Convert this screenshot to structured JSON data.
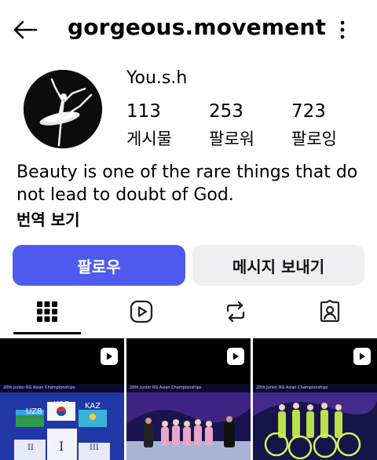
{
  "header": {
    "username": "gorgeous.movement",
    "back_icon": "arrow-left-icon",
    "more_icon": "more-vertical-icon"
  },
  "profile": {
    "display_name": "You.s.h",
    "stats": [
      {
        "count": "113",
        "label": "게시물"
      },
      {
        "count": "253",
        "label": "팔로워"
      },
      {
        "count": "723",
        "label": "팔로잉"
      }
    ],
    "bio": "Beauty is one of the rare things that do not lead to doubt of God.",
    "translate_label": "번역 보기"
  },
  "actions": {
    "follow_label": "팔로우",
    "message_label": "메시지 보내기",
    "follow_color": "#4f5bf0"
  },
  "tabs": [
    {
      "icon": "grid-icon",
      "active": true
    },
    {
      "icon": "reels-icon",
      "active": false
    },
    {
      "icon": "repost-icon",
      "active": false
    },
    {
      "icon": "tagged-icon",
      "active": false
    }
  ],
  "posts": [
    {
      "type": "video",
      "banner": "20th Junior RG Asian Championships",
      "flags": [
        "UZB",
        "KOR",
        "KAZ"
      ],
      "places": [
        "II",
        "I",
        "III"
      ]
    },
    {
      "type": "video",
      "banner": "20th Junior RG Asian Championships"
    },
    {
      "type": "video",
      "banner": "20th Junior RG Asian Championships"
    }
  ]
}
